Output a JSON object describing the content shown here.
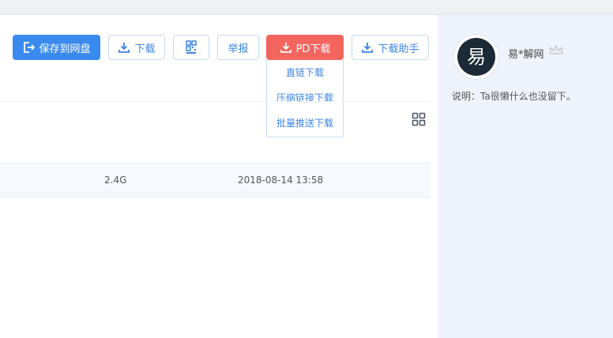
{
  "toolbar": {
    "save_label": "保存到网盘",
    "download_label": "下载",
    "report_label": "举报",
    "pd_label": "PD下载",
    "helper_label": "下载助手"
  },
  "pd_menu": {
    "items": [
      "直链下载",
      "压缩链接下载",
      "批量推送下载"
    ]
  },
  "file_row": {
    "size": "2.4G",
    "date": "2018-08-14 13:58"
  },
  "user": {
    "avatar_char": "易",
    "name": "易*解网",
    "desc": "说明：Ta很懒什么也没留下。"
  },
  "colors": {
    "primary": "#3a8bf0",
    "danger": "#f4655f",
    "sidebar_bg": "#eff4fc"
  },
  "icons": [
    "save-icon",
    "download-icon",
    "qrcode-icon",
    "grid-view-icon",
    "crown-icon"
  ]
}
